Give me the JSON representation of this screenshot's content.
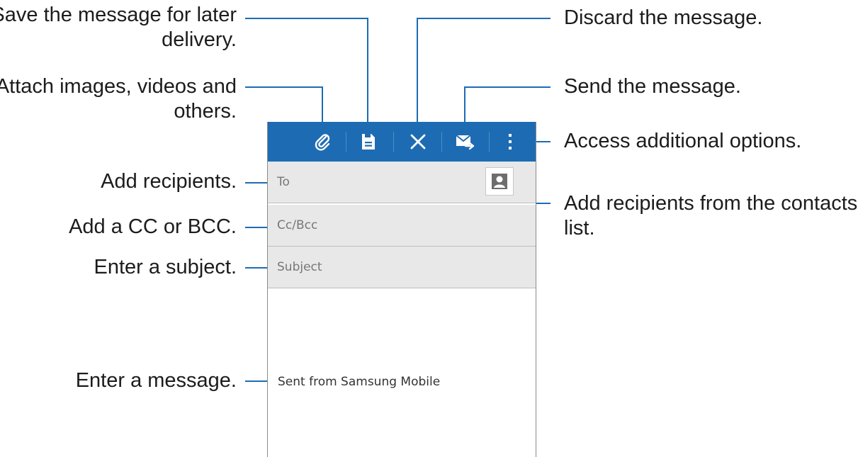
{
  "callouts": {
    "save_line1": "Save the message for later",
    "save_line2": "delivery.",
    "attach_line1": "Attach images, videos and",
    "attach_line2": "others.",
    "add_recipients": "Add recipients.",
    "add_cc_bcc": "Add a CC or BCC.",
    "enter_subject": "Enter a subject.",
    "enter_message": "Enter a message.",
    "discard": "Discard the message.",
    "send": "Send the message.",
    "more_options": "Access additional options.",
    "contacts_line1": "Add recipients from the contacts",
    "contacts_line2": "list."
  },
  "compose": {
    "to_placeholder": "To",
    "cc_bcc_placeholder": "Cc/Bcc",
    "subject_placeholder": "Subject",
    "signature": "Sent from Samsung Mobile"
  },
  "icons": {
    "attach": "paperclip-icon",
    "save": "save-draft-icon",
    "discard": "close-icon",
    "send": "send-mail-icon",
    "more": "overflow-menu-icon",
    "contacts": "contact-person-icon"
  },
  "colors": {
    "action_bar": "#1d6cb3",
    "callout_line": "#1d6cb3",
    "field_background": "#e8e8e8"
  }
}
